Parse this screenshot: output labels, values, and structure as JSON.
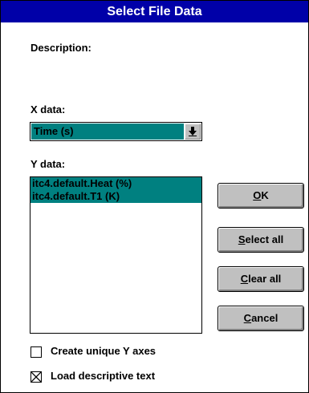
{
  "window": {
    "title": "Select File Data"
  },
  "description": {
    "label": "Description:"
  },
  "x_data": {
    "label": "X data:",
    "selected": "Time (s)",
    "dropdown_icon": "down-arrow-icon"
  },
  "y_data": {
    "label": "Y data:",
    "items": [
      "itc4.default.Heat (%)",
      "itc4.default.T1 (K)"
    ]
  },
  "buttons": {
    "ok": {
      "mnemonic": "O",
      "rest": "K"
    },
    "select_all": {
      "mnemonic": "S",
      "rest": "elect all"
    },
    "clear_all": {
      "mnemonic": "C",
      "rest": "lear all"
    },
    "cancel": {
      "mnemonic": "C",
      "rest": "ancel"
    }
  },
  "options": {
    "unique_y_axes": {
      "label": "Create unique Y axes",
      "checked": false
    },
    "load_desc_text": {
      "label": "Load descriptive text",
      "checked": true
    }
  }
}
